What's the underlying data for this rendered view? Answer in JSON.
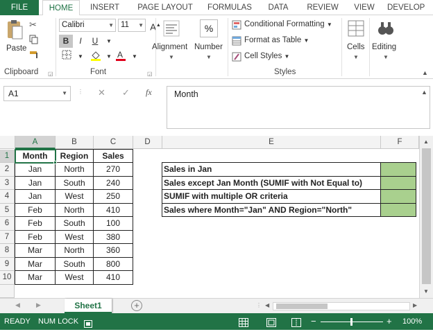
{
  "tabs": [
    "FILE",
    "HOME",
    "INSERT",
    "PAGE LAYOUT",
    "FORMULAS",
    "DATA",
    "REVIEW",
    "VIEW",
    "DEVELOP"
  ],
  "ribbon": {
    "paste": "Paste",
    "clipboard": "Clipboard",
    "font_name": "Calibri",
    "font_size": "11",
    "font_group": "Font",
    "bold": "B",
    "italic": "I",
    "underline": "U",
    "alignment": "Alignment",
    "number": "Number",
    "conditional": "Conditional Formatting",
    "format_table": "Format as Table",
    "cell_styles": "Cell Styles",
    "styles": "Styles",
    "cells": "Cells",
    "editing": "Editing",
    "percent": "%"
  },
  "formula_bar": {
    "name_box": "A1",
    "fx": "fx",
    "content": "Month"
  },
  "columns": [
    "A",
    "B",
    "C",
    "D",
    "E",
    "F"
  ],
  "rows": [
    "1",
    "2",
    "3",
    "4",
    "5",
    "6",
    "7",
    "8",
    "9",
    "10"
  ],
  "table": {
    "headers": [
      "Month",
      "Region",
      "Sales"
    ],
    "data": [
      [
        "Jan",
        "North",
        "270"
      ],
      [
        "Jan",
        "South",
        "240"
      ],
      [
        "Jan",
        "West",
        "250"
      ],
      [
        "Feb",
        "North",
        "410"
      ],
      [
        "Feb",
        "South",
        "100"
      ],
      [
        "Feb",
        "West",
        "380"
      ],
      [
        "Mar",
        "North",
        "360"
      ],
      [
        "Mar",
        "South",
        "800"
      ],
      [
        "Mar",
        "West",
        "410"
      ]
    ]
  },
  "questions": [
    "Sales in Jan",
    "Sales except Jan Month (SUMIF with Not Equal to)",
    "SUMIF with multiple OR criteria",
    "Sales where Month=\"Jan\" AND Region=\"North\""
  ],
  "sheet_tab": "Sheet1",
  "status": {
    "ready": "READY",
    "numlock": "NUM LOCK",
    "zoom": "100%"
  },
  "colors": {
    "excel_green": "#217346",
    "answer_fill": "#a9d08e"
  }
}
